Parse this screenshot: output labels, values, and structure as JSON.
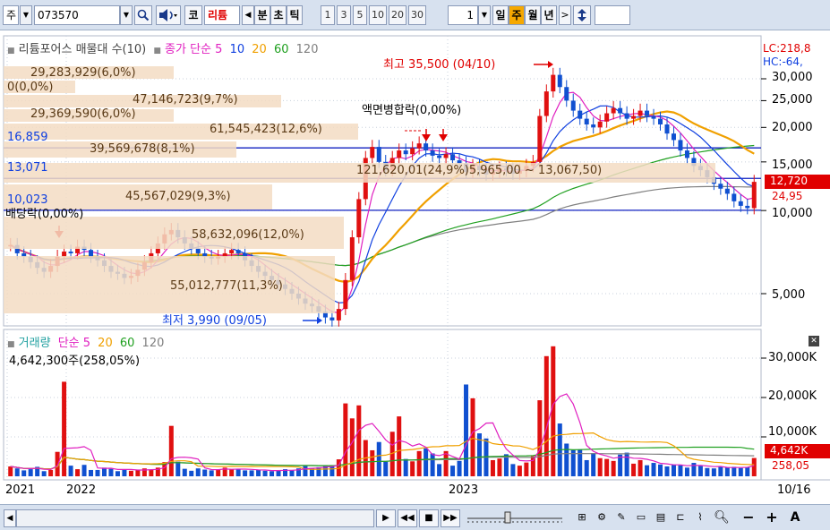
{
  "toolbar": {
    "market_label": "주",
    "stock_code": "073570",
    "search_icon": "magnifier-icon",
    "sound_icon": "speaker-icon",
    "market_tag": "코",
    "stock_name": "리튬",
    "prev_arrow": "◀",
    "period_minute": "분",
    "period_tick_a": "초",
    "period_tick_b": "틱",
    "interval_buttons": [
      "1",
      "3",
      "5",
      "10",
      "20",
      "30"
    ],
    "count_value": "1",
    "period_day": "일",
    "period_week": "주",
    "period_month": "월",
    "period_year": "년",
    "next_arrow": ">",
    "updown_icon": "updown-arrow-icon"
  },
  "price_panel": {
    "title": "리튬포어스 매물대 수(10)",
    "ma_label": "종가 단순",
    "ma_periods": [
      "5",
      "10",
      "20",
      "60",
      "120"
    ],
    "ma_colors": [
      "#e020c0",
      "#1040e0",
      "#f0a000",
      "#20a020",
      "#808080"
    ],
    "lc_label": "LC:218,8",
    "hc_label": "HC:-64,",
    "price_ticks": [
      "30,000",
      "25,000",
      "20,000",
      "15,000",
      "10,000",
      "5,000"
    ],
    "current_price_box": "12,720",
    "current_pct": "24,95",
    "high_label": "최고 35,500 (04/10)",
    "low_label": "최저 3,990 (09/05)",
    "event_label": "액면병합락(0,00%)",
    "dividend_label": "배당락(0,00%)",
    "level_labels": [
      "16,859",
      "13,071",
      "10,023"
    ],
    "range_label": "121,620,01(24,9%)5,965,00 ~ 13,067,50)",
    "volume_profile": [
      "29,283,929(6,0%)",
      "0(0,0%)",
      "47,146,723(9,7%)",
      "29,369,590(6,0%)",
      "61,545,423(12,6%)",
      "39,569,678(8,1%)",
      "45,567,029(9,3%)",
      "58,632,096(12,0%)",
      "55,012,777(11,3%)"
    ]
  },
  "volume_panel": {
    "title": "거래량",
    "ma_label": "단순",
    "ma_periods": [
      "5",
      "20",
      "60",
      "120"
    ],
    "current_volume": "4,642,300주(258,05%)",
    "ticks": [
      "30,000K",
      "20,000K",
      "10,000K"
    ],
    "current_box": "4,642K",
    "current_pct": "258,05",
    "close_icon": "close-icon"
  },
  "x_axis": {
    "labels": [
      "2021",
      "2022",
      "2023"
    ],
    "date_box": "10/16"
  },
  "bottom_toolbar": {
    "scroll_left": "◀",
    "play_icon": "play-icon",
    "rewind_icon": "rewind-icon",
    "stop_icon": "stop-icon",
    "forward_icon": "fast-forward-icon",
    "zoom_slider": "zoom-slider",
    "tool_icons": [
      "chart-type-icon",
      "settings-icon",
      "analysis-icon",
      "window-icon",
      "compare-icon",
      "period-icon",
      "drawing-icon"
    ],
    "search_icon": "magnifier-icon",
    "minus_label": "−",
    "plus_label": "+",
    "font_label": "A"
  },
  "chart_data": {
    "type": "line",
    "title": "리튬포어스 매물대 수(10)",
    "weekly_close": [
      7.5,
      7.0,
      6.8,
      6.5,
      6.2,
      6.0,
      6.3,
      6.8,
      7.1,
      7.0,
      7.4,
      7.2,
      6.8,
      6.6,
      6.3,
      6.0,
      5.9,
      5.7,
      5.8,
      6.1,
      6.5,
      7.0,
      7.6,
      8.2,
      8.5,
      8.0,
      7.6,
      7.3,
      7.0,
      6.8,
      6.7,
      6.8,
      7.0,
      7.2,
      7.0,
      6.6,
      6.3,
      6.0,
      5.8,
      5.6,
      5.4,
      5.2,
      5.0,
      4.8,
      4.6,
      4.5,
      4.3,
      4.1,
      4.0,
      4.4,
      5.6,
      8.0,
      11.0,
      15.5,
      17.0,
      15.0,
      14.0,
      15.5,
      16.5,
      16.0,
      16.8,
      17.5,
      16.5,
      15.8,
      15.5,
      16.0,
      15.2,
      14.8,
      13.8,
      14.5,
      14.0,
      13.5,
      13.8,
      14.2,
      14.0,
      13.6,
      13.9,
      14.5,
      15.0,
      22.0,
      27.0,
      31.0,
      28.0,
      25.0,
      23.0,
      21.5,
      20.5,
      20.0,
      21.0,
      22.5,
      23.5,
      22.5,
      21.5,
      22.0,
      23.0,
      22.0,
      21.5,
      20.5,
      19.0,
      18.0,
      16.5,
      15.5,
      14.5,
      14.0,
      13.2,
      12.5,
      12.0,
      11.5,
      10.8,
      10.4,
      10.2,
      12.7
    ],
    "volume_k": [
      2500,
      2000,
      1500,
      1800,
      2400,
      1300,
      1600,
      6200,
      24000,
      2700,
      1800,
      2900,
      1600,
      1600,
      2200,
      1900,
      1300,
      1800,
      1400,
      1500,
      2000,
      1700,
      2200,
      3600,
      12800,
      3700,
      1900,
      1400,
      2000,
      1700,
      1500,
      1800,
      2200,
      1700,
      1900,
      1500,
      1500,
      1600,
      1400,
      1300,
      1500,
      1800,
      1600,
      2000,
      2600,
      2100,
      2300,
      2600,
      2700,
      4300,
      18500,
      14700,
      18000,
      9200,
      6600,
      8700,
      3700,
      11300,
      15200,
      4400,
      3800,
      6400,
      7100,
      5800,
      3100,
      6400,
      2700,
      3900,
      23300,
      19800,
      10900,
      9600,
      4100,
      4500,
      5600,
      3100,
      2700,
      3500,
      5100,
      19300,
      30500,
      33000,
      13400,
      8300,
      6600,
      6800,
      4100,
      5900,
      4600,
      4400,
      3900,
      5500,
      6000,
      3200,
      4100,
      2800,
      3400,
      3000,
      2500,
      2900,
      2800,
      2200,
      3400,
      2600,
      2100,
      2000,
      2400,
      2200,
      2400,
      2100,
      2300,
      4642
    ],
    "xlabel": "",
    "ylabel": "",
    "ylim": [
      3.5,
      33
    ]
  }
}
